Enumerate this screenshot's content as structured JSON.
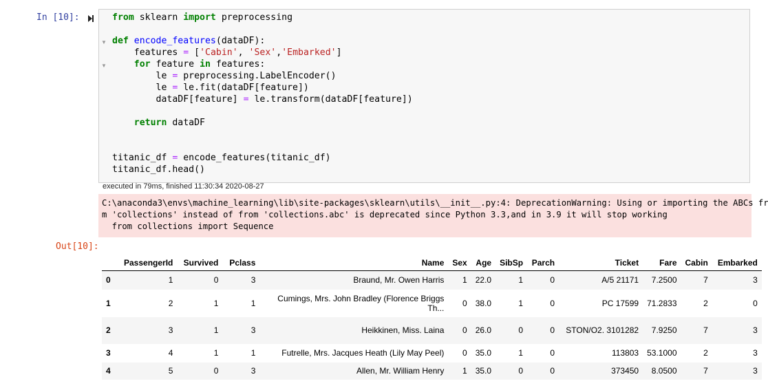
{
  "notebook": {
    "in_prompt": "In [10]:",
    "out_prompt": "Out[10]:",
    "exec_info": "executed in 79ms, finished 11:30:34 2020-08-27"
  },
  "code_lines": [
    [
      {
        "t": "from",
        "c": "kw"
      },
      {
        "t": " sklearn "
      },
      {
        "t": "import",
        "c": "kw"
      },
      {
        "t": " preprocessing"
      }
    ],
    [],
    [
      {
        "t": "def",
        "c": "kw"
      },
      {
        "t": " "
      },
      {
        "t": "encode_features",
        "c": "def"
      },
      {
        "t": "(dataDF):"
      }
    ],
    [
      {
        "t": "    features "
      },
      {
        "t": "=",
        "c": "op"
      },
      {
        "t": " ["
      },
      {
        "t": "'Cabin'",
        "c": "str"
      },
      {
        "t": ", "
      },
      {
        "t": "'Sex'",
        "c": "str"
      },
      {
        "t": ","
      },
      {
        "t": "'Embarked'",
        "c": "str"
      },
      {
        "t": "]"
      }
    ],
    [
      {
        "t": "    "
      },
      {
        "t": "for",
        "c": "kw"
      },
      {
        "t": " feature "
      },
      {
        "t": "in",
        "c": "kw"
      },
      {
        "t": " features:"
      }
    ],
    [
      {
        "t": "        le "
      },
      {
        "t": "=",
        "c": "op"
      },
      {
        "t": " preprocessing.LabelEncoder()"
      }
    ],
    [
      {
        "t": "        le "
      },
      {
        "t": "=",
        "c": "op"
      },
      {
        "t": " le.fit(dataDF[feature])"
      }
    ],
    [
      {
        "t": "        dataDF[feature] "
      },
      {
        "t": "=",
        "c": "op"
      },
      {
        "t": " le.transform(dataDF[feature])"
      }
    ],
    [],
    [
      {
        "t": "    "
      },
      {
        "t": "return",
        "c": "kw"
      },
      {
        "t": " dataDF"
      }
    ],
    [],
    [],
    [
      {
        "t": "titanic_df "
      },
      {
        "t": "=",
        "c": "op"
      },
      {
        "t": " encode_features(titanic_df)"
      }
    ],
    [
      {
        "t": "titanic_df.head()"
      }
    ]
  ],
  "warning_text": "C:\\anaconda3\\envs\\machine_learning\\lib\\site-packages\\sklearn\\utils\\__init__.py:4: DeprecationWarning: Using or importing the ABCs fro\nm 'collections' instead of from 'collections.abc' is deprecated since Python 3.3,and in 3.9 it will stop working\n  from collections import Sequence",
  "table": {
    "columns": [
      "",
      "PassengerId",
      "Survived",
      "Pclass",
      "Name",
      "Sex",
      "Age",
      "SibSp",
      "Parch",
      "Ticket",
      "Fare",
      "Cabin",
      "Embarked"
    ],
    "rows": [
      [
        "0",
        "1",
        "0",
        "3",
        "Braund, Mr. Owen Harris",
        "1",
        "22.0",
        "1",
        "0",
        "A/5 21171",
        "7.2500",
        "7",
        "3"
      ],
      [
        "1",
        "2",
        "1",
        "1",
        "Cumings, Mrs. John Bradley (Florence Briggs Th...",
        "0",
        "38.0",
        "1",
        "0",
        "PC 17599",
        "71.2833",
        "2",
        "0"
      ],
      [
        "2",
        "3",
        "1",
        "3",
        "Heikkinen, Miss. Laina",
        "0",
        "26.0",
        "0",
        "0",
        "STON/O2. 3101282",
        "7.9250",
        "7",
        "3"
      ],
      [
        "3",
        "4",
        "1",
        "1",
        "Futrelle, Mrs. Jacques Heath (Lily May Peel)",
        "0",
        "35.0",
        "1",
        "0",
        "113803",
        "53.1000",
        "2",
        "3"
      ],
      [
        "4",
        "5",
        "0",
        "3",
        "Allen, Mr. William Henry",
        "1",
        "35.0",
        "0",
        "0",
        "373450",
        "8.0500",
        "7",
        "3"
      ]
    ]
  },
  "icons": {
    "run": "run-cell-icon",
    "fold": "fold-arrow-icon"
  }
}
